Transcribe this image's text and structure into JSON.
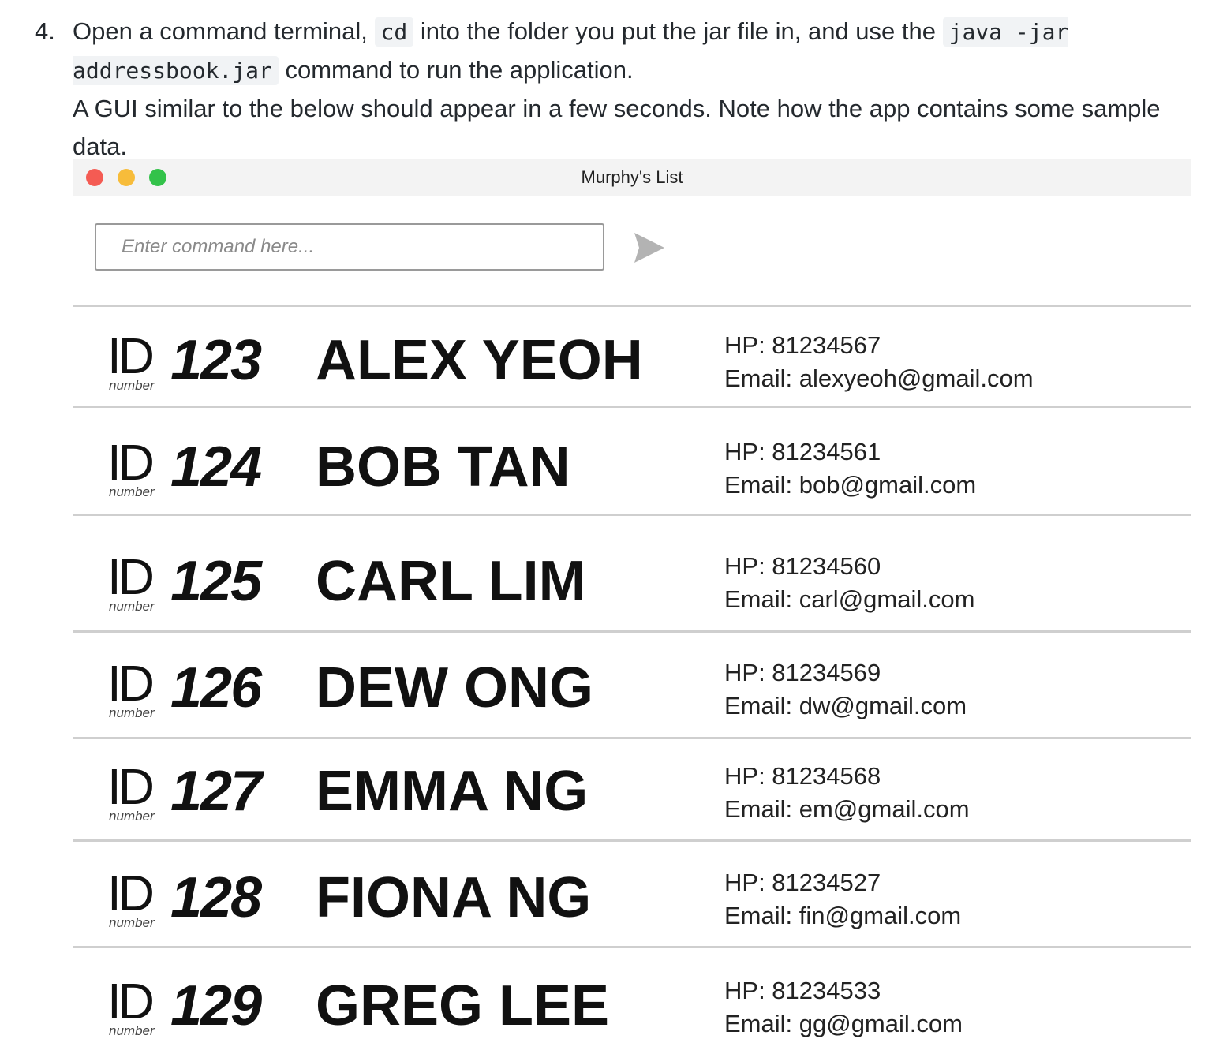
{
  "instruction": {
    "step_number": "4.",
    "line_parts": [
      "Open a command terminal, ",
      "cd",
      " into the folder you put the jar file in, and use the ",
      "java -jar addressbook.jar",
      " command to run the application."
    ],
    "note": "A GUI similar to the below should appear in a few seconds. Note how the app contains some sample data."
  },
  "window": {
    "title": "Murphy's List",
    "command_placeholder": "Enter command here...",
    "send_icon": "send-arrow-icon"
  },
  "labels": {
    "id_word": "ID",
    "id_sub": "number"
  },
  "contacts": [
    {
      "id": "123",
      "name": "ALEX YEOH",
      "hp": "HP: 81234567",
      "email": "Email: alexyeoh@gmail.com"
    },
    {
      "id": "124",
      "name": "BOB TAN",
      "hp": "HP: 81234561",
      "email": "Email: bob@gmail.com"
    },
    {
      "id": "125",
      "name": "CARL LIM",
      "hp": "HP: 81234560",
      "email": "Email: carl@gmail.com"
    },
    {
      "id": "126",
      "name": "DEW ONG",
      "hp": "HP: 81234569",
      "email": "Email: dw@gmail.com"
    },
    {
      "id": "127",
      "name": "EMMA NG",
      "hp": "HP: 81234568",
      "email": "Email: em@gmail.com"
    },
    {
      "id": "128",
      "name": "FIONA NG",
      "hp": "HP: 81234527",
      "email": "Email: fin@gmail.com"
    },
    {
      "id": "129",
      "name": "GREG LEE",
      "hp": "HP: 81234533",
      "email": "Email: gg@gmail.com"
    }
  ],
  "colors": {
    "close": "#f45b53",
    "minimize": "#f7bc3a",
    "zoom": "#33c24a",
    "send_arrow": "#b3b3b3"
  }
}
